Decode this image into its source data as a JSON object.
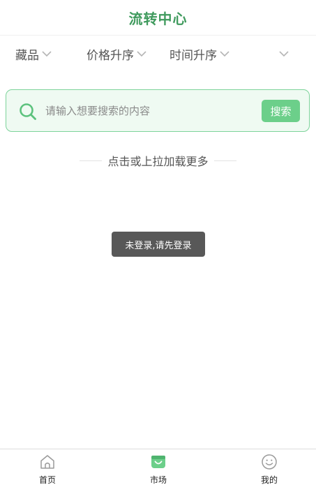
{
  "header": {
    "title": "流转中心"
  },
  "filters": {
    "category_label": "藏品",
    "price_sort_label": "价格升序",
    "time_sort_label": "时间升序",
    "extra_label": ""
  },
  "search": {
    "placeholder": "请输入想要搜索的内容",
    "button_label": "搜索"
  },
  "list": {
    "load_more_text": "点击或上拉加载更多"
  },
  "toast": {
    "message": "未登录,请先登录"
  },
  "tabbar": {
    "items": [
      {
        "label": "首页",
        "icon": "home-icon",
        "active": false
      },
      {
        "label": "市场",
        "icon": "shopping-bag-icon",
        "active": true
      },
      {
        "label": "我的",
        "icon": "smile-icon",
        "active": false
      }
    ]
  },
  "colors": {
    "brand_green": "#3f9a5d",
    "accent_green": "#6ccf8a",
    "search_border": "#7dd39a",
    "search_background": "#effaf2",
    "toast_background": "#585858"
  }
}
